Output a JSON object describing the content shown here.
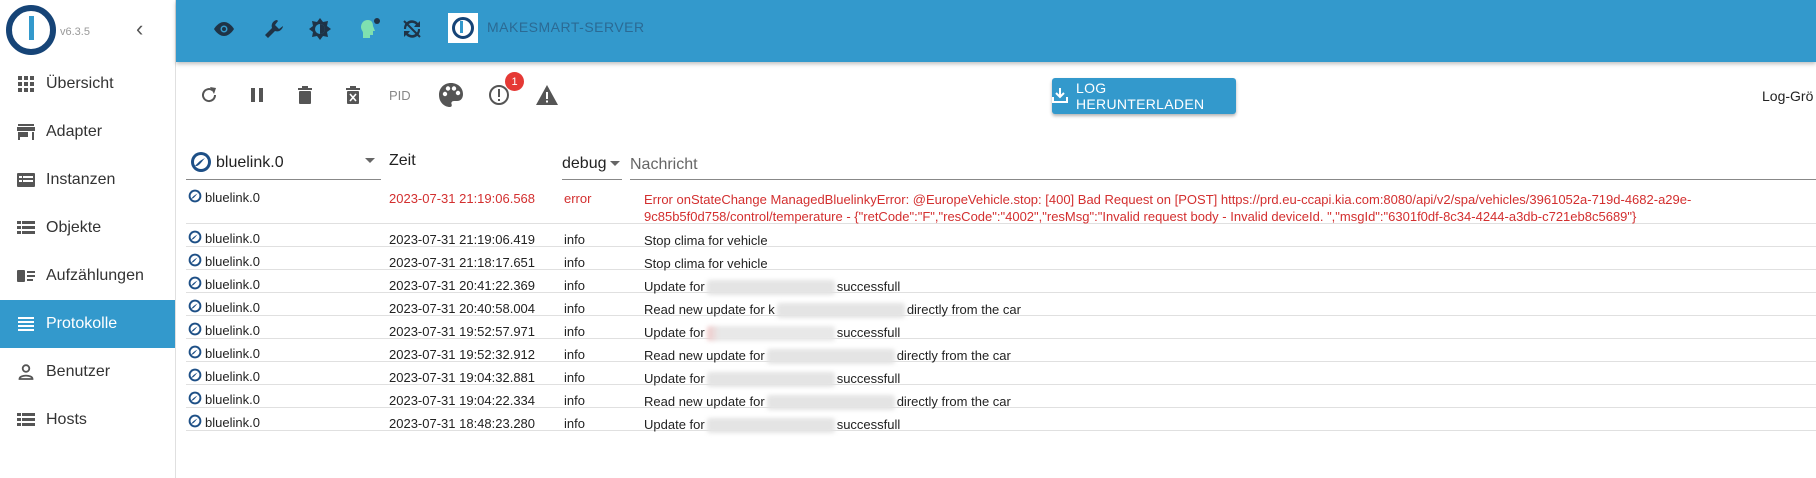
{
  "app": {
    "version": "v6.3.5",
    "server_name": "MAKESMART-SERVER"
  },
  "sidebar": {
    "items": [
      {
        "label": "Übersicht",
        "icon": "apps-grid-icon"
      },
      {
        "label": "Adapter",
        "icon": "store-icon"
      },
      {
        "label": "Instanzen",
        "icon": "instances-icon"
      },
      {
        "label": "Objekte",
        "icon": "list-icon"
      },
      {
        "label": "Aufzählungen",
        "icon": "enum-icon"
      },
      {
        "label": "Protokolle",
        "icon": "log-lines-icon",
        "active": true
      },
      {
        "label": "Benutzer",
        "icon": "user-icon"
      },
      {
        "label": "Hosts",
        "icon": "hosts-icon"
      }
    ]
  },
  "header": {
    "icons": [
      "eye-icon",
      "wrench-icon",
      "theme-icon",
      "expert-mode-icon",
      "sync-off-icon"
    ]
  },
  "toolbar": {
    "pid_label": "PID",
    "errors_badge": "1",
    "download_label": "LOG HERUNTERLADEN",
    "log_size_label": "Log-Grö"
  },
  "table": {
    "source_filter": "bluelink.0",
    "time_header": "Zeit",
    "level_filter": "debug",
    "message_placeholder": "Nachricht",
    "rows": [
      {
        "src": "bluelink.0",
        "time": "2023-07-31 21:19:06.568",
        "level": "error",
        "msg": "Error onStateChange ManagedBluelinkyError: @EuropeVehicle.stop: [400] Bad Request on [POST] https://prd.eu-ccapi.kia.com:8080/api/v2/spa/vehicles/3961052a-719d-4682-a29e-9c85b5f0d758/control/temperature - {\"retCode\":\"F\",\"resCode\":\"4002\",\"resMsg\":\"Invalid request body - Invalid deviceId. \",\"msgId\":\"6301f0df-8c34-4244-a3db-c721eb8c5689\"}"
      },
      {
        "src": "bluelink.0",
        "time": "2023-07-31 21:19:06.419",
        "level": "info",
        "msg": "Stop clima for vehicle"
      },
      {
        "src": "bluelink.0",
        "time": "2023-07-31 21:18:17.651",
        "level": "info",
        "msg": "Stop clima for vehicle"
      },
      {
        "src": "bluelink.0",
        "time": "2023-07-31 20:41:22.369",
        "level": "info",
        "msg_pre": "Update for",
        "msg_post": "successfull"
      },
      {
        "src": "bluelink.0",
        "time": "2023-07-31 20:40:58.004",
        "level": "info",
        "msg_pre": "Read new update for k",
        "msg_post": "directly from the car"
      },
      {
        "src": "bluelink.0",
        "time": "2023-07-31 19:52:57.971",
        "level": "info",
        "msg_pre": "Update for",
        "msg_post": "successfull"
      },
      {
        "src": "bluelink.0",
        "time": "2023-07-31 19:52:32.912",
        "level": "info",
        "msg_pre": "Read new update for",
        "msg_post": "directly from the car"
      },
      {
        "src": "bluelink.0",
        "time": "2023-07-31 19:04:32.881",
        "level": "info",
        "msg_pre": "Update for",
        "msg_post": "successfull"
      },
      {
        "src": "bluelink.0",
        "time": "2023-07-31 19:04:22.334",
        "level": "info",
        "msg_pre": "Read new update for",
        "msg_post": "directly from the car"
      },
      {
        "src": "bluelink.0",
        "time": "2023-07-31 18:48:23.280",
        "level": "info",
        "msg_pre": "Update for",
        "msg_post": "successfull"
      }
    ]
  },
  "colors": {
    "accent": "#3399cc",
    "error": "#d32f2f",
    "badge": "#e53935"
  }
}
